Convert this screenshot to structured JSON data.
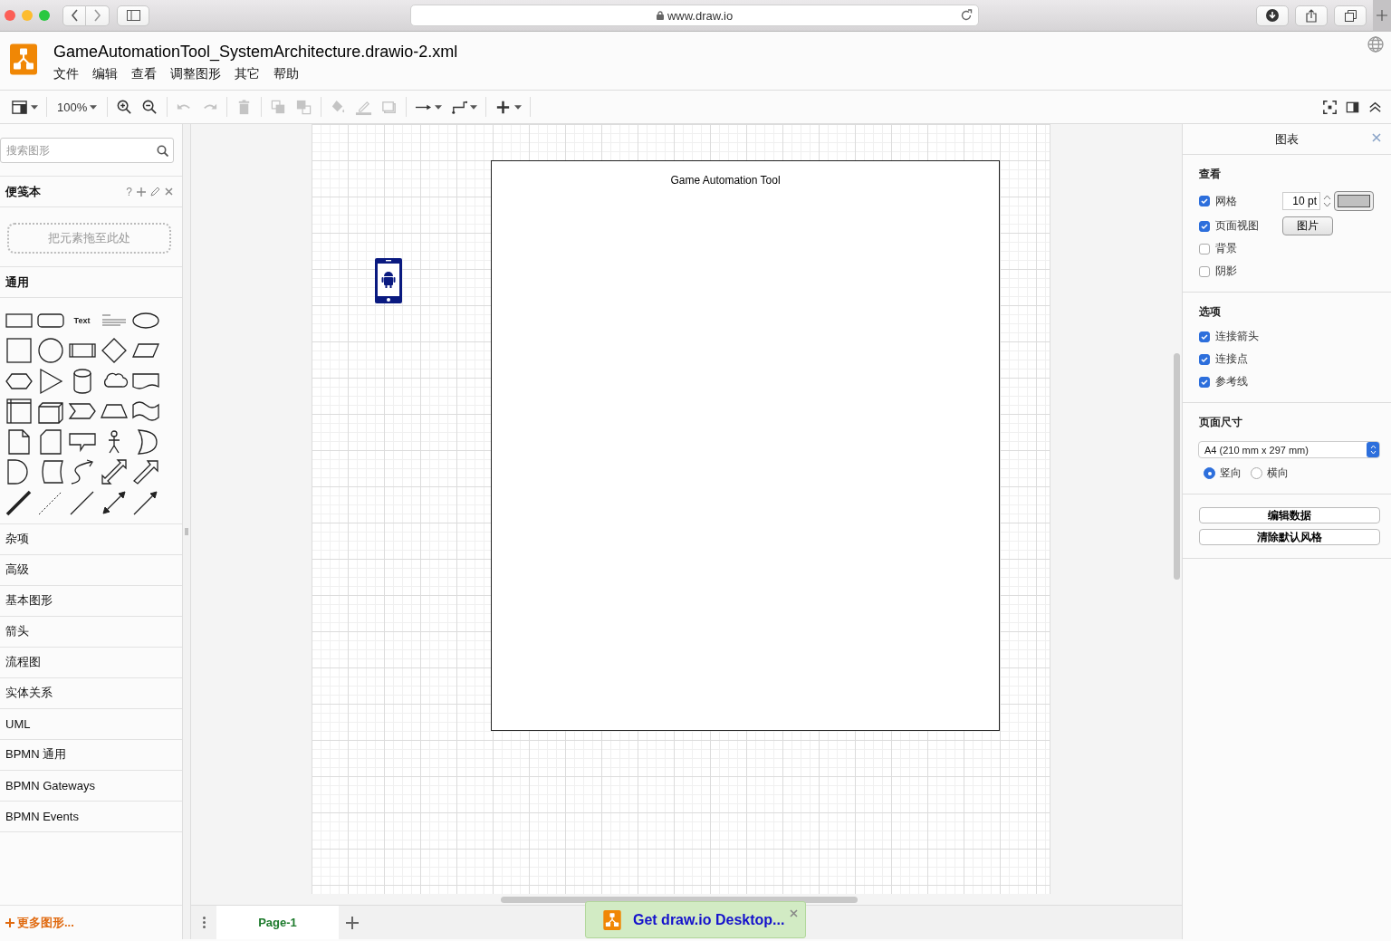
{
  "browser": {
    "url": "www.draw.io"
  },
  "app": {
    "title": "GameAutomationTool_SystemArchitecture.drawio-2.xml",
    "menus": [
      "文件",
      "编辑",
      "查看",
      "调整图形",
      "其它",
      "帮助"
    ]
  },
  "toolbar": {
    "groups": [
      [
        {
          "kind": "layout",
          "disabled": false
        }
      ],
      [
        {
          "kind": "zoom",
          "label": "100%",
          "disabled": false
        }
      ],
      [
        {
          "kind": "zoom-in",
          "disabled": false
        },
        {
          "kind": "zoom-out",
          "disabled": false
        }
      ],
      [
        {
          "kind": "undo",
          "disabled": true
        },
        {
          "kind": "redo",
          "disabled": true
        }
      ],
      [
        {
          "kind": "delete",
          "disabled": true
        }
      ],
      [
        {
          "kind": "to-front",
          "disabled": true
        },
        {
          "kind": "to-back",
          "disabled": true
        }
      ],
      [
        {
          "kind": "fill",
          "disabled": true
        },
        {
          "kind": "line-color",
          "disabled": true
        },
        {
          "kind": "shadow",
          "disabled": true
        }
      ],
      [
        {
          "kind": "connection",
          "disabled": false
        },
        {
          "kind": "waypoints",
          "disabled": false
        }
      ],
      [
        {
          "kind": "insert",
          "disabled": false
        }
      ]
    ],
    "right": [
      {
        "kind": "fullscreen"
      },
      {
        "kind": "format-panel"
      },
      {
        "kind": "collapse"
      }
    ]
  },
  "shapes_panel": {
    "search": {
      "placeholder": "搜索图形"
    },
    "scratchpad": {
      "title": "便笺本",
      "help": "?",
      "drop_hint": "把元素拖至此处"
    },
    "general": {
      "title": "通用",
      "text_shape": "Text"
    },
    "sections": [
      {
        "title": "杂项"
      },
      {
        "title": "高级"
      },
      {
        "title": "基本图形"
      },
      {
        "title": "箭头"
      },
      {
        "title": "流程图"
      },
      {
        "title": "实体关系"
      },
      {
        "title": "UML"
      },
      {
        "title": "BPMN 通用"
      },
      {
        "title": "BPMN Gateways"
      },
      {
        "title": "BPMN Events"
      }
    ],
    "more_shapes": "更多图形..."
  },
  "diagram": {
    "container": {
      "title": "Game Automation Tool"
    }
  },
  "format_panel": {
    "title": "图表",
    "view": {
      "title": "查看",
      "options": [
        {
          "label": "网格",
          "checked": true
        },
        {
          "label": "页面视图",
          "checked": true
        },
        {
          "label": "背景",
          "checked": false
        },
        {
          "label": "阴影",
          "checked": false
        }
      ],
      "grid_size": "10 pt",
      "image_button": "图片"
    },
    "options": {
      "title": "选项",
      "options": [
        {
          "label": "连接箭头",
          "checked": true
        },
        {
          "label": "连接点",
          "checked": true
        },
        {
          "label": "参考线",
          "checked": true
        }
      ]
    },
    "page_size": {
      "title": "页面尺寸",
      "select": "A4 (210 mm x 297 mm)",
      "orientations": [
        {
          "label": "竖向",
          "selected": true
        },
        {
          "label": "横向",
          "selected": false
        }
      ]
    },
    "buttons": [
      "编辑数据",
      "清除默认风格"
    ]
  },
  "pages": [
    {
      "label": "Page-1",
      "selected": true
    }
  ],
  "banner": {
    "text": "Get draw.io Desktop..."
  }
}
